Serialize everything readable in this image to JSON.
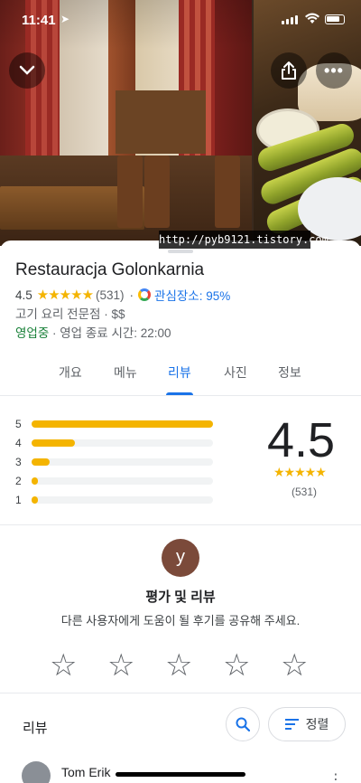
{
  "status_bar": {
    "time": "11:41"
  },
  "place": {
    "name": "Restauracja Golonkarnia",
    "rating": "4.5",
    "rating_stars": "★★★★★",
    "review_count": "(531)",
    "separator": "·",
    "interest_label": "관심장소: 95%",
    "category": "고기 요리 전문점 · $$",
    "open_status": "영업중",
    "hours": " · 영업 종료 시간: 22:00"
  },
  "watermark": "http://pyb9121.tistory.com",
  "tabs": [
    "개요",
    "메뉴",
    "리뷰",
    "사진",
    "정보"
  ],
  "active_tab": "리뷰",
  "rating_summary": {
    "score": "4.5",
    "stars": "★★★★★",
    "count": "(531)",
    "distribution": [
      {
        "label": "5",
        "fraction": 1.0
      },
      {
        "label": "4",
        "fraction": 0.24
      },
      {
        "label": "3",
        "fraction": 0.1
      },
      {
        "label": "2",
        "fraction": 0.03
      },
      {
        "label": "1",
        "fraction": 0.03
      }
    ]
  },
  "write_review": {
    "avatar_letter": "y",
    "title": "평가 및 리뷰",
    "subtitle": "다른 사용자에게 도움이 될 후기를 공유해 주세요.",
    "star_glyph": "☆"
  },
  "reviews": {
    "title": "리뷰",
    "sort_label": "정렬",
    "first_reviewer": "Tom Erik",
    "more_glyph": "⋮"
  },
  "colors": {
    "accent": "#1a73e8",
    "star": "#f4b400",
    "open": "#188038"
  },
  "icons": [
    "chevron-down-icon",
    "share-icon",
    "more-icon",
    "search-icon",
    "sort-icon"
  ]
}
